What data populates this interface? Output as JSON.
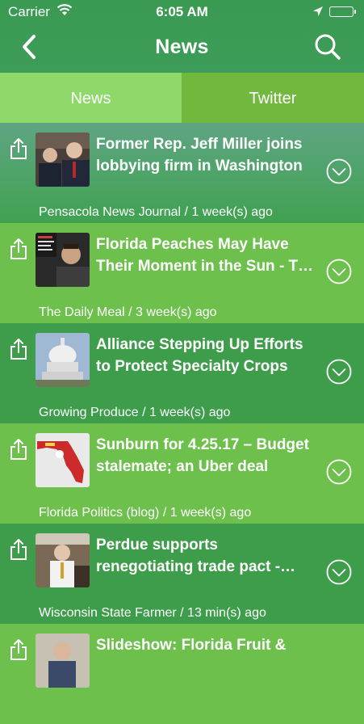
{
  "status_bar": {
    "carrier": "Carrier",
    "time": "6:05 AM"
  },
  "nav": {
    "title": "News"
  },
  "tabs": [
    {
      "label": "News",
      "selected": true
    },
    {
      "label": "Twitter",
      "selected": false
    }
  ],
  "articles": [
    {
      "headline": "Former Rep. Jeff Miller joins lobbying firm in Washington",
      "source": "Pensacola News Journal / 1 week(s) ago",
      "thumb": "politicians-photo"
    },
    {
      "headline": "Florida Peaches May Have Their Moment in the Sun - The Daily Meal",
      "source": "The Daily Meal / 3 week(s) ago",
      "thumb": "speaker-photo"
    },
    {
      "headline": "Alliance Stepping Up Efforts to Protect Specialty Crops",
      "source": "Growing Produce / 1 week(s) ago",
      "thumb": "capitol-dome-photo"
    },
    {
      "headline": "Sunburn for 4.25.17 – Budget stalemate; an Uber deal",
      "source": "Florida Politics (blog) / 1 week(s) ago",
      "thumb": "florida-map-image"
    },
    {
      "headline": "Perdue supports renegotiating trade pact - Wisconsin",
      "source": "Wisconsin State Farmer / 13 min(s) ago",
      "thumb": "perdue-photo"
    },
    {
      "headline": "Slideshow: Florida Fruit &",
      "source": "",
      "thumb": "man-photo"
    }
  ],
  "colors": {
    "tab_selected": "#8fd96a",
    "tab_unselected": "#73b83e",
    "row_dark": "#3e9d4b",
    "row_light": "#6dc04c"
  }
}
